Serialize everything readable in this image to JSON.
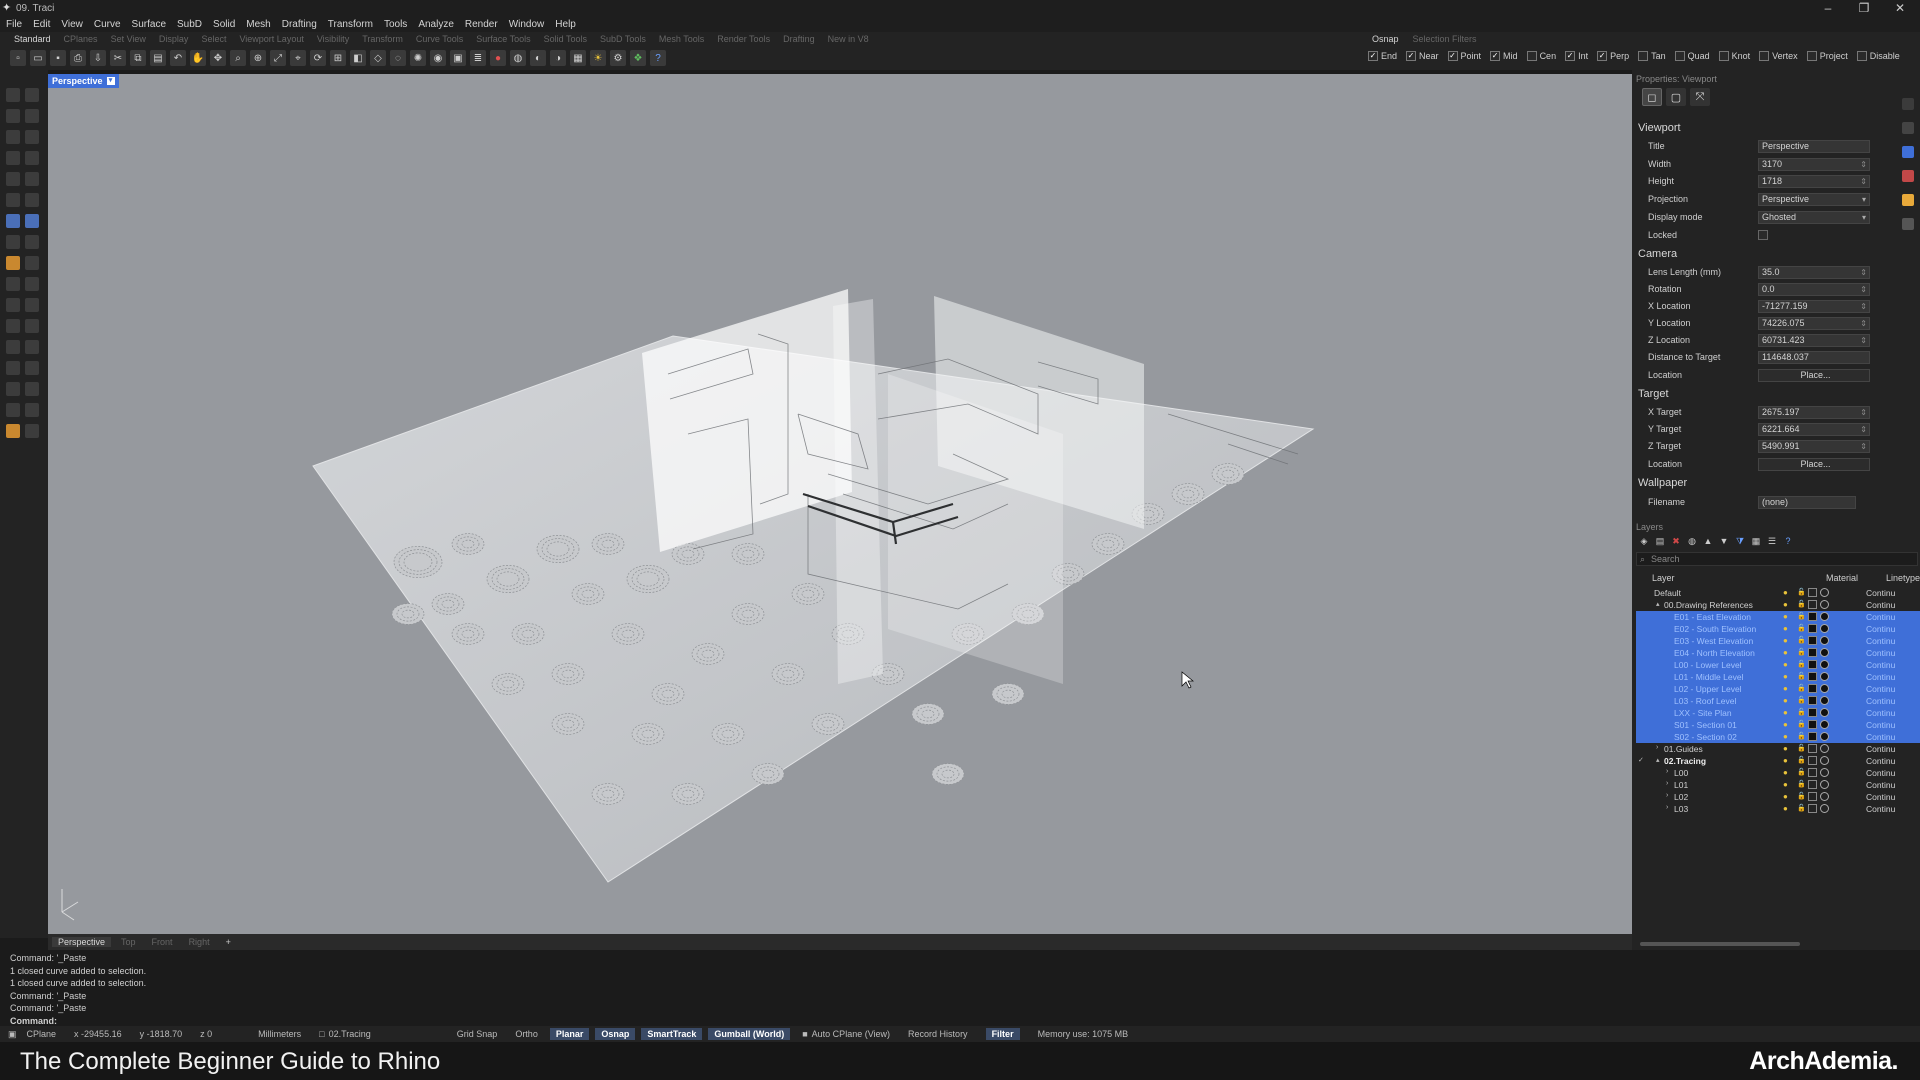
{
  "window": {
    "title": "09. Traci"
  },
  "menu": [
    "File",
    "Edit",
    "View",
    "Curve",
    "Surface",
    "SubD",
    "Solid",
    "Mesh",
    "Drafting",
    "Transform",
    "Tools",
    "Analyze",
    "Render",
    "Window",
    "Help"
  ],
  "tabs": [
    "Standard",
    "CPlanes",
    "Set View",
    "Display",
    "Select",
    "Viewport Layout",
    "Visibility",
    "Transform",
    "Curve Tools",
    "Surface Tools",
    "Solid Tools",
    "SubD Tools",
    "Mesh Tools",
    "Render Tools",
    "Drafting",
    "New in V8"
  ],
  "osnap": {
    "tabs": [
      "Osnap",
      "Selection Filters"
    ],
    "items": [
      {
        "label": "End",
        "checked": true
      },
      {
        "label": "Near",
        "checked": true
      },
      {
        "label": "Point",
        "checked": true
      },
      {
        "label": "Mid",
        "checked": true
      },
      {
        "label": "Cen",
        "checked": false
      },
      {
        "label": "Int",
        "checked": true
      },
      {
        "label": "Perp",
        "checked": true
      },
      {
        "label": "Tan",
        "checked": false
      },
      {
        "label": "Quad",
        "checked": false
      },
      {
        "label": "Knot",
        "checked": false
      },
      {
        "label": "Vertex",
        "checked": false
      },
      {
        "label": "Project",
        "checked": false
      },
      {
        "label": "Disable",
        "checked": false
      }
    ]
  },
  "viewport": {
    "label": "Perspective",
    "background": "#96999e"
  },
  "viewport_tabs": [
    "Perspective",
    "Top",
    "Front",
    "Right",
    "+"
  ],
  "command_lines": [
    "Command: '_Paste",
    "1 closed curve added to selection.",
    "1 closed curve added to selection.",
    "Command: '_Paste",
    "Command: '_Paste",
    "Command:"
  ],
  "status": {
    "cplane": "CPlane",
    "x": "x -29455.16",
    "y": "y -1818.70",
    "z": "z 0",
    "units": "Millimeters",
    "layer": "02.Tracing",
    "toggles": [
      {
        "label": "Grid Snap",
        "on": false
      },
      {
        "label": "Ortho",
        "on": false
      },
      {
        "label": "Planar",
        "on": true
      },
      {
        "label": "Osnap",
        "on": true
      },
      {
        "label": "SmartTrack",
        "on": true
      },
      {
        "label": "Gumball (World)",
        "on": true
      }
    ],
    "auto_cplane": "Auto CPlane (View)",
    "record_history": "Record History",
    "filter": "Filter",
    "memory": "Memory use: 1075 MB"
  },
  "banner": {
    "caption": "The Complete Beginner Guide to Rhino",
    "brand": "ArchAdemia."
  },
  "properties": {
    "header": "Properties: Viewport",
    "viewport_section": "Viewport",
    "camera_section": "Camera",
    "target_section": "Target",
    "wallpaper_section": "Wallpaper",
    "title": {
      "label": "Title",
      "value": "Perspective"
    },
    "width": {
      "label": "Width",
      "value": "3170"
    },
    "height": {
      "label": "Height",
      "value": "1718"
    },
    "projection": {
      "label": "Projection",
      "value": "Perspective"
    },
    "display_mode": {
      "label": "Display mode",
      "value": "Ghosted"
    },
    "locked": {
      "label": "Locked"
    },
    "lens": {
      "label": "Lens Length (mm)",
      "value": "35.0"
    },
    "rotation": {
      "label": "Rotation",
      "value": "0.0"
    },
    "x_location": {
      "label": "X Location",
      "value": "-71277.159"
    },
    "y_location": {
      "label": "Y Location",
      "value": "74226.075"
    },
    "z_location": {
      "label": "Z Location",
      "value": "60731.423"
    },
    "distance": {
      "label": "Distance to Target",
      "value": "114648.037"
    },
    "location": {
      "label": "Location",
      "value": "Place..."
    },
    "x_target": {
      "label": "X Target",
      "value": "2675.197"
    },
    "y_target": {
      "label": "Y Target",
      "value": "6221.664"
    },
    "z_target": {
      "label": "Z Target",
      "value": "5490.991"
    },
    "target_location": {
      "label": "Location",
      "value": "Place..."
    },
    "filename": {
      "label": "Filename",
      "value": "(none)"
    }
  },
  "layers": {
    "header": "Layers",
    "search_placeholder": "Search",
    "col_layer": "Layer",
    "col_material": "Material",
    "col_linetype": "Linetype",
    "rows": [
      {
        "name": "Default",
        "indent": 0,
        "selected": false,
        "bold": false,
        "lt": "Continu"
      },
      {
        "name": "00.Drawing References",
        "indent": 1,
        "selected": false,
        "bold": false,
        "lt": "Continu",
        "exp": "▴"
      },
      {
        "name": "E01 - East Elevation",
        "indent": 2,
        "selected": true,
        "bold": false,
        "lt": "Continu"
      },
      {
        "name": "E02 - South Elevation",
        "indent": 2,
        "selected": true,
        "bold": false,
        "lt": "Continu"
      },
      {
        "name": "E03 - West Elevation",
        "indent": 2,
        "selected": true,
        "bold": false,
        "lt": "Continu"
      },
      {
        "name": "E04 - North Elevation",
        "indent": 2,
        "selected": true,
        "bold": false,
        "lt": "Continu"
      },
      {
        "name": "L00 - Lower Level",
        "indent": 2,
        "selected": true,
        "bold": false,
        "lt": "Continu"
      },
      {
        "name": "L01 - Middle Level",
        "indent": 2,
        "selected": true,
        "bold": false,
        "lt": "Continu"
      },
      {
        "name": "L02 - Upper Level",
        "indent": 2,
        "selected": true,
        "bold": false,
        "lt": "Continu"
      },
      {
        "name": "L03 - Roof Level",
        "indent": 2,
        "selected": true,
        "bold": false,
        "lt": "Continu"
      },
      {
        "name": "LXX - Site Plan",
        "indent": 2,
        "selected": true,
        "bold": false,
        "lt": "Continu"
      },
      {
        "name": "S01 - Section 01",
        "indent": 2,
        "selected": true,
        "bold": false,
        "lt": "Continu"
      },
      {
        "name": "S02 - Section 02",
        "indent": 2,
        "selected": true,
        "bold": false,
        "lt": "Continu"
      },
      {
        "name": "01.Guides",
        "indent": 1,
        "selected": false,
        "bold": false,
        "lt": "Continu",
        "exp": "›"
      },
      {
        "name": "02.Tracing",
        "indent": 1,
        "selected": false,
        "bold": true,
        "lt": "Continu",
        "exp": "▴",
        "current": true
      },
      {
        "name": "L00",
        "indent": 2,
        "selected": false,
        "bold": false,
        "lt": "Continu",
        "exp": "›"
      },
      {
        "name": "L01",
        "indent": 2,
        "selected": false,
        "bold": false,
        "lt": "Continu",
        "exp": "›"
      },
      {
        "name": "L02",
        "indent": 2,
        "selected": false,
        "bold": false,
        "lt": "Continu",
        "exp": "›"
      },
      {
        "name": "L03",
        "indent": 2,
        "selected": false,
        "bold": false,
        "lt": "Continu",
        "exp": "›"
      }
    ]
  },
  "colors": {
    "accent": "#3f6fd8",
    "viewport_bg": "#96999e",
    "panel_bg": "#232323"
  }
}
